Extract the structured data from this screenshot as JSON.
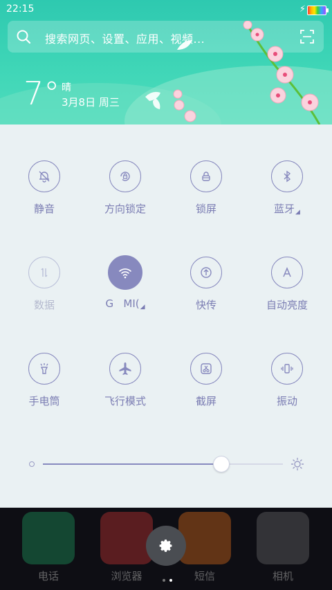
{
  "status_bar": {
    "time": "22:15"
  },
  "search": {
    "placeholder": "搜索网页、设置、应用、视频..."
  },
  "weather": {
    "temperature": "7°",
    "condition": "晴",
    "date": "3月8日 周三"
  },
  "quick_settings": {
    "row1": [
      {
        "label": "静音",
        "icon": "bell-off-icon",
        "state": "off"
      },
      {
        "label": "方向锁定",
        "icon": "rotation-lock-icon",
        "state": "off"
      },
      {
        "label": "锁屏",
        "icon": "lock-icon",
        "state": "off"
      },
      {
        "label": "蓝牙",
        "icon": "bluetooth-icon",
        "state": "off"
      }
    ],
    "row2": [
      {
        "label": "数据",
        "icon": "data-arrows-icon",
        "state": "disabled"
      },
      {
        "label": "G   MI(",
        "icon": "wifi-icon",
        "state": "on"
      },
      {
        "label": "快传",
        "icon": "transfer-icon",
        "state": "off"
      },
      {
        "label": "自动亮度",
        "icon": "auto-brightness-icon",
        "state": "off"
      }
    ],
    "row3": [
      {
        "label": "手电筒",
        "icon": "flashlight-icon",
        "state": "off"
      },
      {
        "label": "飞行模式",
        "icon": "airplane-icon",
        "state": "off"
      },
      {
        "label": "截屏",
        "icon": "screenshot-icon",
        "state": "off"
      },
      {
        "label": "振动",
        "icon": "vibrate-icon",
        "state": "off"
      }
    ],
    "brightness_level": 0.74
  },
  "dock": {
    "apps": [
      {
        "label": "电话",
        "color": "#1fb36b"
      },
      {
        "label": "浏览器",
        "color": "#e83a36"
      },
      {
        "label": "短信",
        "color": "#ff7a1a"
      },
      {
        "label": "相机",
        "color": "#444444"
      }
    ],
    "page_indicator": {
      "pages": 2,
      "current": 2
    }
  },
  "colors": {
    "accent": "#8789be",
    "header": "#3fd6b7",
    "panel": "#eaf1f3"
  }
}
